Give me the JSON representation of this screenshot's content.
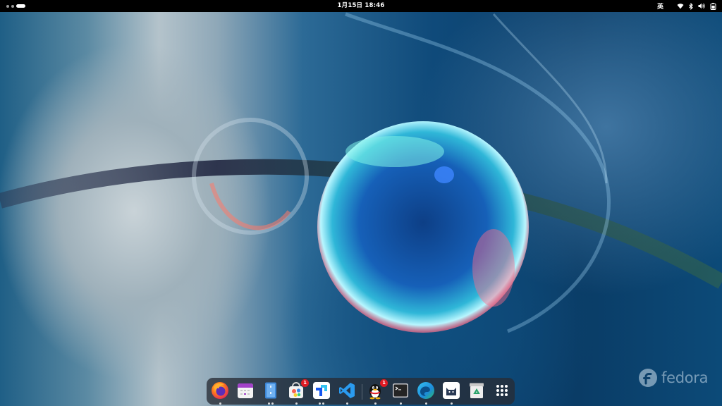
{
  "topbar": {
    "clock": "1月15日  18:46",
    "input_method": "英",
    "workspaces": [
      "workspace-1",
      "workspace-2",
      "workspace-3-active"
    ]
  },
  "status_icons": [
    "wifi-icon",
    "bluetooth-icon",
    "volume-icon",
    "battery-icon"
  ],
  "dock": {
    "apps": [
      {
        "name": "Firefox",
        "icon": "firefox-icon",
        "running": 1,
        "badge": ""
      },
      {
        "name": "Calendar",
        "icon": "calendar-icon",
        "running": 0,
        "badge": ""
      },
      {
        "name": "File Manager",
        "icon": "files-icon",
        "running": 2,
        "badge": ""
      },
      {
        "name": "Software",
        "icon": "software-store-icon",
        "running": 1,
        "badge": "1"
      },
      {
        "name": "Feishu",
        "icon": "feishu-icon",
        "running": 2,
        "badge": ""
      },
      {
        "name": "Visual Studio Code",
        "icon": "vscode-icon",
        "running": 1,
        "badge": ""
      },
      {
        "name": "QQ",
        "icon": "qq-penguin-icon",
        "running": 1,
        "badge": "1"
      },
      {
        "name": "Terminal",
        "icon": "terminal-icon",
        "running": 1,
        "badge": ""
      },
      {
        "name": "Microsoft Edge",
        "icon": "edge-icon",
        "running": 1,
        "badge": ""
      },
      {
        "name": "Clash",
        "icon": "cat-app-icon",
        "running": 1,
        "badge": ""
      },
      {
        "name": "Trash",
        "icon": "trash-icon",
        "running": 0,
        "badge": ""
      },
      {
        "name": "Show Apps",
        "icon": "app-grid-icon",
        "running": 0,
        "badge": ""
      }
    ]
  },
  "watermark": {
    "text": "fedora"
  },
  "colors": {
    "topbar": "#000000",
    "dock": "#282c34",
    "badge": "#e01b24"
  }
}
